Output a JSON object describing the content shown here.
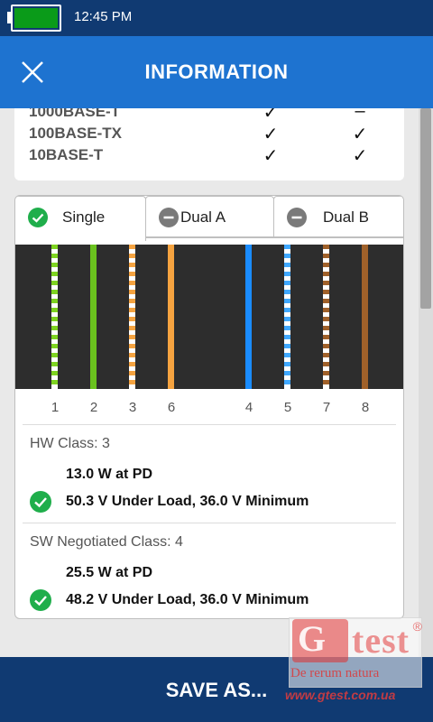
{
  "status_bar": {
    "time": "12:45 PM",
    "battery_level": 1.0,
    "battery_color": "#0a9b19"
  },
  "header": {
    "title": "INFORMATION",
    "close_icon": "close-x-icon"
  },
  "speeds": [
    {
      "name": "1000BASE-T",
      "pair_a": "✓",
      "pair_b": "–"
    },
    {
      "name": "100BASE-TX",
      "pair_a": "✓",
      "pair_b": "✓"
    },
    {
      "name": "10BASE-T",
      "pair_a": "✓",
      "pair_b": "✓"
    }
  ],
  "tabs": [
    {
      "label": "Single",
      "state": "active",
      "icon": "check-circle-icon"
    },
    {
      "label": "Dual A",
      "state": "inactive",
      "icon": "minus-circle-icon"
    },
    {
      "label": "Dual B",
      "state": "inactive",
      "icon": "minus-circle-icon"
    }
  ],
  "wires": [
    {
      "pin": "1",
      "color": "#7ed321",
      "striped": true
    },
    {
      "pin": "2",
      "color": "#6ac21e",
      "striped": false
    },
    {
      "pin": "3",
      "color": "#f5a340",
      "striped": true
    },
    {
      "pin": "6",
      "color": "#f5a340",
      "striped": false
    },
    {
      "pin": "4",
      "color": "#1a8cff",
      "striped": false
    },
    {
      "pin": "5",
      "color": "#40a8ff",
      "striped": true
    },
    {
      "pin": "7",
      "color": "#a0612a",
      "striped": true
    },
    {
      "pin": "8",
      "color": "#a0612a",
      "striped": false
    }
  ],
  "hw_class": {
    "label": "HW Class: 3",
    "power": "13.0 W at PD",
    "voltage": "50.3 V Under Load, 36.0 V Minimum",
    "status": "pass"
  },
  "sw_class": {
    "label": "SW Negotiated Class: 4",
    "power": "25.5 W at PD",
    "voltage": "48.2 V Under Load, 36.0 V Minimum",
    "status": "pass"
  },
  "footer": {
    "save_label": "SAVE AS..."
  },
  "watermark": {
    "logo": "Gtest",
    "motto": "De rerum natura",
    "url": "www.gtest.com.ua"
  },
  "colors": {
    "status_bar": "#103a72",
    "header": "#1e73d0",
    "pass_green": "#1fae4b",
    "neutral_grey": "#7a7a7a"
  }
}
